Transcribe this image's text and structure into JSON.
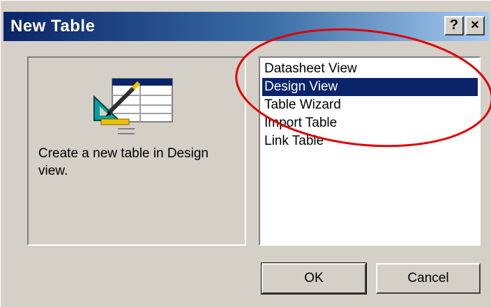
{
  "window": {
    "title": "New Table",
    "help_glyph": "?",
    "close_glyph": "×"
  },
  "preview": {
    "icon": "design-view-table-icon",
    "description": "Create a new table in Design view."
  },
  "list": {
    "items": [
      "Datasheet View",
      "Design View",
      "Table Wizard",
      "Import Table",
      "Link Table"
    ],
    "selected_index": 1
  },
  "buttons": {
    "ok": "OK",
    "cancel": "Cancel"
  },
  "colors": {
    "titlebar_start": "#0a246a",
    "titlebar_end": "#a6caf0",
    "selection": "#0a246a",
    "annotation": "#e00000",
    "face": "#d4d0c8"
  }
}
